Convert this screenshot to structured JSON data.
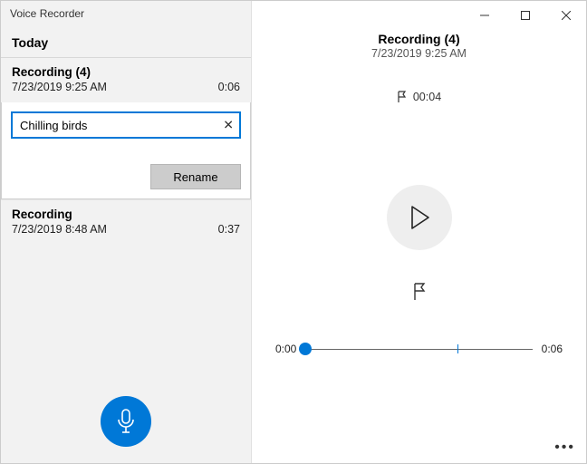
{
  "app_title": "Voice Recorder",
  "sidebar": {
    "group_label": "Today",
    "items": [
      {
        "title": "Recording (4)",
        "date": "7/23/2019 9:25 AM",
        "duration": "0:06"
      },
      {
        "title": "Recording",
        "date": "7/23/2019 8:48 AM",
        "duration": "0:37"
      }
    ]
  },
  "rename": {
    "input_value": "Chilling birds",
    "button_label": "Rename"
  },
  "detail": {
    "title": "Recording (4)",
    "date": "7/23/2019 9:25 AM",
    "marker_time": "00:04",
    "timeline": {
      "start": "0:00",
      "end": "0:06",
      "position_pct": 0,
      "marker_pct": 67
    }
  },
  "colors": {
    "accent": "#0078d7"
  }
}
